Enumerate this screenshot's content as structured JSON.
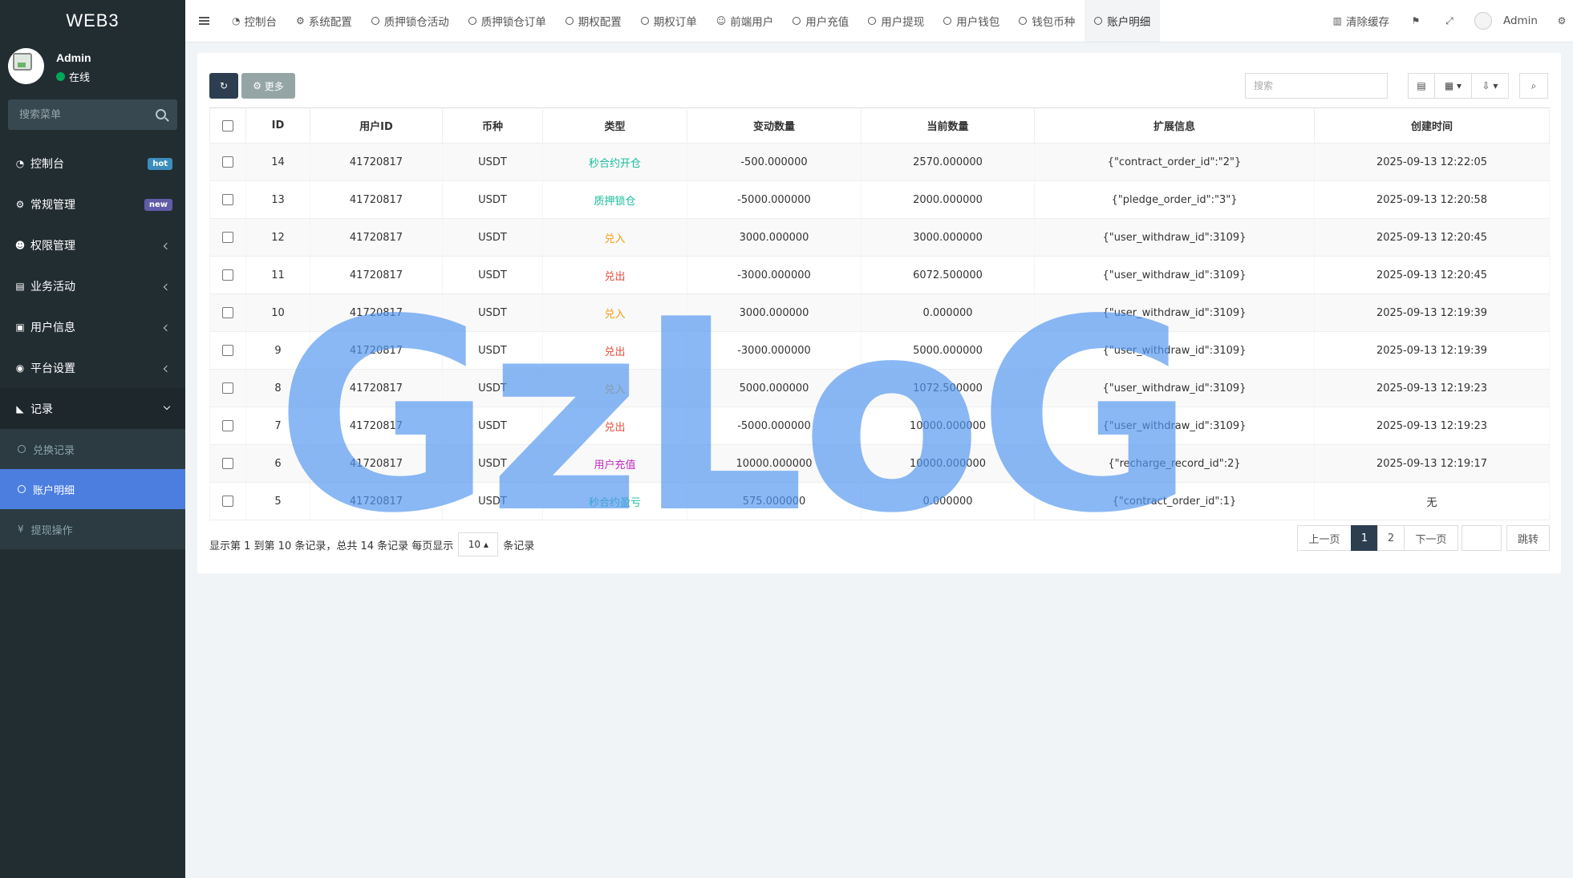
{
  "brand": "WEB3",
  "user": {
    "name": "Admin",
    "status": "在线"
  },
  "menu_search": {
    "placeholder": "搜索菜单"
  },
  "sidebar": {
    "items": [
      {
        "label": "控制台",
        "icon": "dashboard-icon",
        "badge": "hot"
      },
      {
        "label": "常规管理",
        "icon": "cogs-icon",
        "badge": "new"
      },
      {
        "label": "权限管理",
        "icon": "group-icon"
      },
      {
        "label": "业务活动",
        "icon": "list-alt-icon"
      },
      {
        "label": "用户信息",
        "icon": "book-icon"
      },
      {
        "label": "平台设置",
        "icon": "gear-icon"
      },
      {
        "label": "记录",
        "icon": "area-chart-icon"
      }
    ],
    "sub_items": [
      {
        "label": "兑换记录"
      },
      {
        "label": "账户明细",
        "active": true
      },
      {
        "label": "提现操作"
      }
    ]
  },
  "tabs": [
    {
      "label": "控制台"
    },
    {
      "label": "系统配置"
    },
    {
      "label": "质押锁仓活动"
    },
    {
      "label": "质押锁仓订单"
    },
    {
      "label": "期权配置"
    },
    {
      "label": "期权订单"
    },
    {
      "label": "前端用户"
    },
    {
      "label": "用户充值"
    },
    {
      "label": "用户提现"
    },
    {
      "label": "用户钱包"
    },
    {
      "label": "钱包币种"
    },
    {
      "label": "账户明细",
      "active": true
    }
  ],
  "topbar": {
    "clear_cache": "清除缓存",
    "admin": "Admin"
  },
  "toolbar": {
    "more": "更多",
    "search_placeholder": "搜索"
  },
  "table": {
    "headers": [
      "ID",
      "用户ID",
      "币种",
      "类型",
      "变动数量",
      "当前数量",
      "扩展信息",
      "创建时间"
    ],
    "rows": [
      {
        "id": "14",
        "uid": "41720817",
        "coin": "USDT",
        "type": "秒合约开仓",
        "change": "-500.000000",
        "current": "2570.000000",
        "ext": "{\"contract_order_id\":\"2\"}",
        "time": "2025-09-13 12:22:05"
      },
      {
        "id": "13",
        "uid": "41720817",
        "coin": "USDT",
        "type": "质押锁仓",
        "change": "-5000.000000",
        "current": "2000.000000",
        "ext": "{\"pledge_order_id\":\"3\"}",
        "time": "2025-09-13 12:20:58"
      },
      {
        "id": "12",
        "uid": "41720817",
        "coin": "USDT",
        "type": "兑入",
        "change": "3000.000000",
        "current": "3000.000000",
        "ext": "{\"user_withdraw_id\":3109}",
        "time": "2025-09-13 12:20:45"
      },
      {
        "id": "11",
        "uid": "41720817",
        "coin": "USDT",
        "type": "兑出",
        "change": "-3000.000000",
        "current": "6072.500000",
        "ext": "{\"user_withdraw_id\":3109}",
        "time": "2025-09-13 12:20:45"
      },
      {
        "id": "10",
        "uid": "41720817",
        "coin": "USDT",
        "type": "兑入",
        "change": "3000.000000",
        "current": "0.000000",
        "ext": "{\"user_withdraw_id\":3109}",
        "time": "2025-09-13 12:19:39"
      },
      {
        "id": "9",
        "uid": "41720817",
        "coin": "USDT",
        "type": "兑出",
        "change": "-3000.000000",
        "current": "5000.000000",
        "ext": "{\"user_withdraw_id\":3109}",
        "time": "2025-09-13 12:19:39"
      },
      {
        "id": "8",
        "uid": "41720817",
        "coin": "USDT",
        "type": "兑入",
        "change": "5000.000000",
        "current": "1072.500000",
        "ext": "{\"user_withdraw_id\":3109}",
        "time": "2025-09-13 12:19:23"
      },
      {
        "id": "7",
        "uid": "41720817",
        "coin": "USDT",
        "type": "兑出",
        "change": "-5000.000000",
        "current": "10000.000000",
        "ext": "{\"user_withdraw_id\":3109}",
        "time": "2025-09-13 12:19:23"
      },
      {
        "id": "6",
        "uid": "41720817",
        "coin": "USDT",
        "type": "用户充值",
        "change": "10000.000000",
        "current": "10000.000000",
        "ext": "{\"recharge_record_id\":2}",
        "time": "2025-09-13 12:19:17"
      },
      {
        "id": "5",
        "uid": "41720817",
        "coin": "USDT",
        "type": "秒合约盈亏",
        "change": "575.000000",
        "current": "0.000000",
        "ext": "{\"contract_order_id\":1}",
        "time": "无"
      }
    ]
  },
  "type_colors": {
    "秒合约开仓": "#18bc9c",
    "质押锁仓": "#18bc9c",
    "兑入": "#f39c12",
    "兑出": "#e74c3c",
    "用户充值": "#c02ac0",
    "秒合约盈亏": "#18bc9c"
  },
  "pagination": {
    "info_pre": "显示第 1 到第 10 条记录，总共 14 条记录 每页显示",
    "page_size": "10",
    "info_post": "条记录",
    "prev": "上一页",
    "pages": [
      "1",
      "2"
    ],
    "next": "下一页",
    "go": "跳转"
  },
  "watermark": "GzLoG"
}
